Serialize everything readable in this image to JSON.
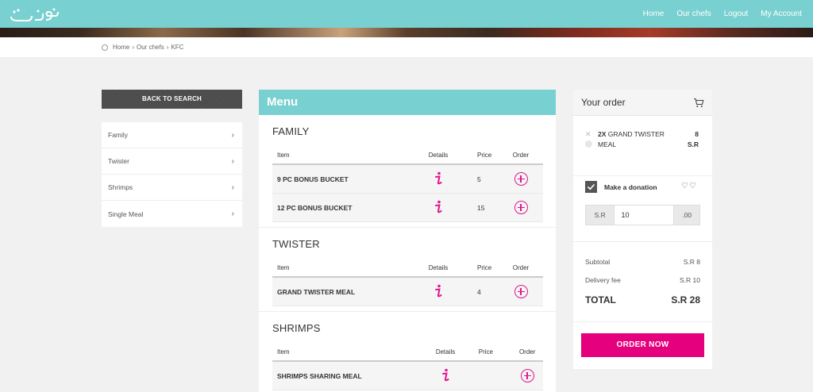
{
  "brand": {
    "logo_text": "وجبات"
  },
  "nav": [
    "Home",
    "Our chefs",
    "Logout",
    "My Account"
  ],
  "breadcrumb": [
    "Home",
    "Our chefs",
    "KFC"
  ],
  "sidebar": {
    "back_label": "BACK TO SEARCH",
    "categories": [
      "Family",
      "Twister",
      "Shrimps",
      "Single Meal"
    ]
  },
  "menu": {
    "title": "Menu",
    "headers": {
      "item": "Item",
      "details": "Details",
      "price": "Price",
      "order": "Order"
    },
    "sections": [
      {
        "title": "FAMILY",
        "items": [
          {
            "name": "9 PC BONUS BUCKET",
            "price": "5"
          },
          {
            "name": "12 PC BONUS BUCKET",
            "price": "15"
          }
        ]
      },
      {
        "title": "TWISTER",
        "items": [
          {
            "name": "GRAND TWISTER MEAL",
            "price": "4"
          }
        ]
      },
      {
        "title": "SHRIMPS",
        "items": [
          {
            "name": "SHRIMPS SHARING MEAL",
            "price": ""
          }
        ]
      }
    ]
  },
  "order": {
    "title": "Your order",
    "item": {
      "qty": "2X",
      "name_line1": "GRAND TWISTER",
      "name_line2": "MEAL",
      "price_line1": "8",
      "price_line2": "S.R"
    },
    "donation_label": "Make a donation",
    "donation_prefix": "S.R",
    "donation_value": "10",
    "donation_suffix": ".00",
    "subtotal_label": "Subtotal",
    "subtotal_value": "S.R 8",
    "delivery_label": "Delivery fee",
    "delivery_value": "S.R 10",
    "total_label": "TOTAL",
    "total_value": "S.R 28",
    "order_now": "ORDER NOW"
  },
  "colors": {
    "teal": "#79d0d0",
    "magenta": "#e5007d",
    "dark_button": "#4a4a4a"
  }
}
